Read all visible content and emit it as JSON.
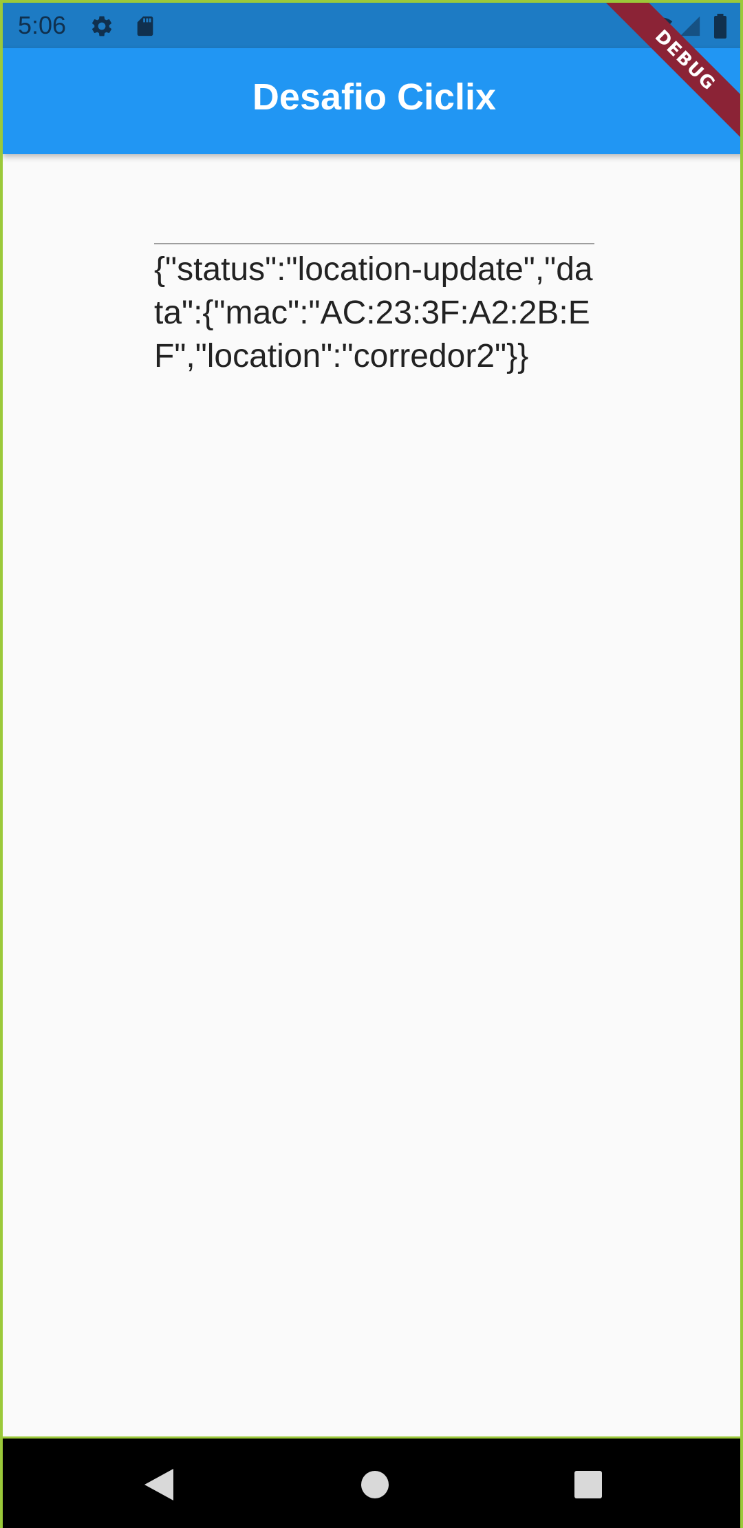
{
  "status_bar": {
    "time": "5:06",
    "left_icons": [
      "gear-icon",
      "sd-card-icon"
    ],
    "right_icons": [
      "wifi-icon",
      "signal-icon",
      "battery-icon"
    ],
    "background": "#1d7bc4"
  },
  "app_bar": {
    "title": "Desafio Ciclix",
    "background": "#2196f3"
  },
  "debug_banner": {
    "label": "DEBUG",
    "color": "#8b2336"
  },
  "main": {
    "message": "{\"status\":\"location-update\",\"data\":{\"mac\":\"AC:23:3F:A2:2B:EF\",\"location\":\"corredor2\"}}",
    "background": "#fafafa"
  },
  "nav_bar": {
    "buttons": [
      "back-icon",
      "home-icon",
      "recents-icon"
    ]
  }
}
